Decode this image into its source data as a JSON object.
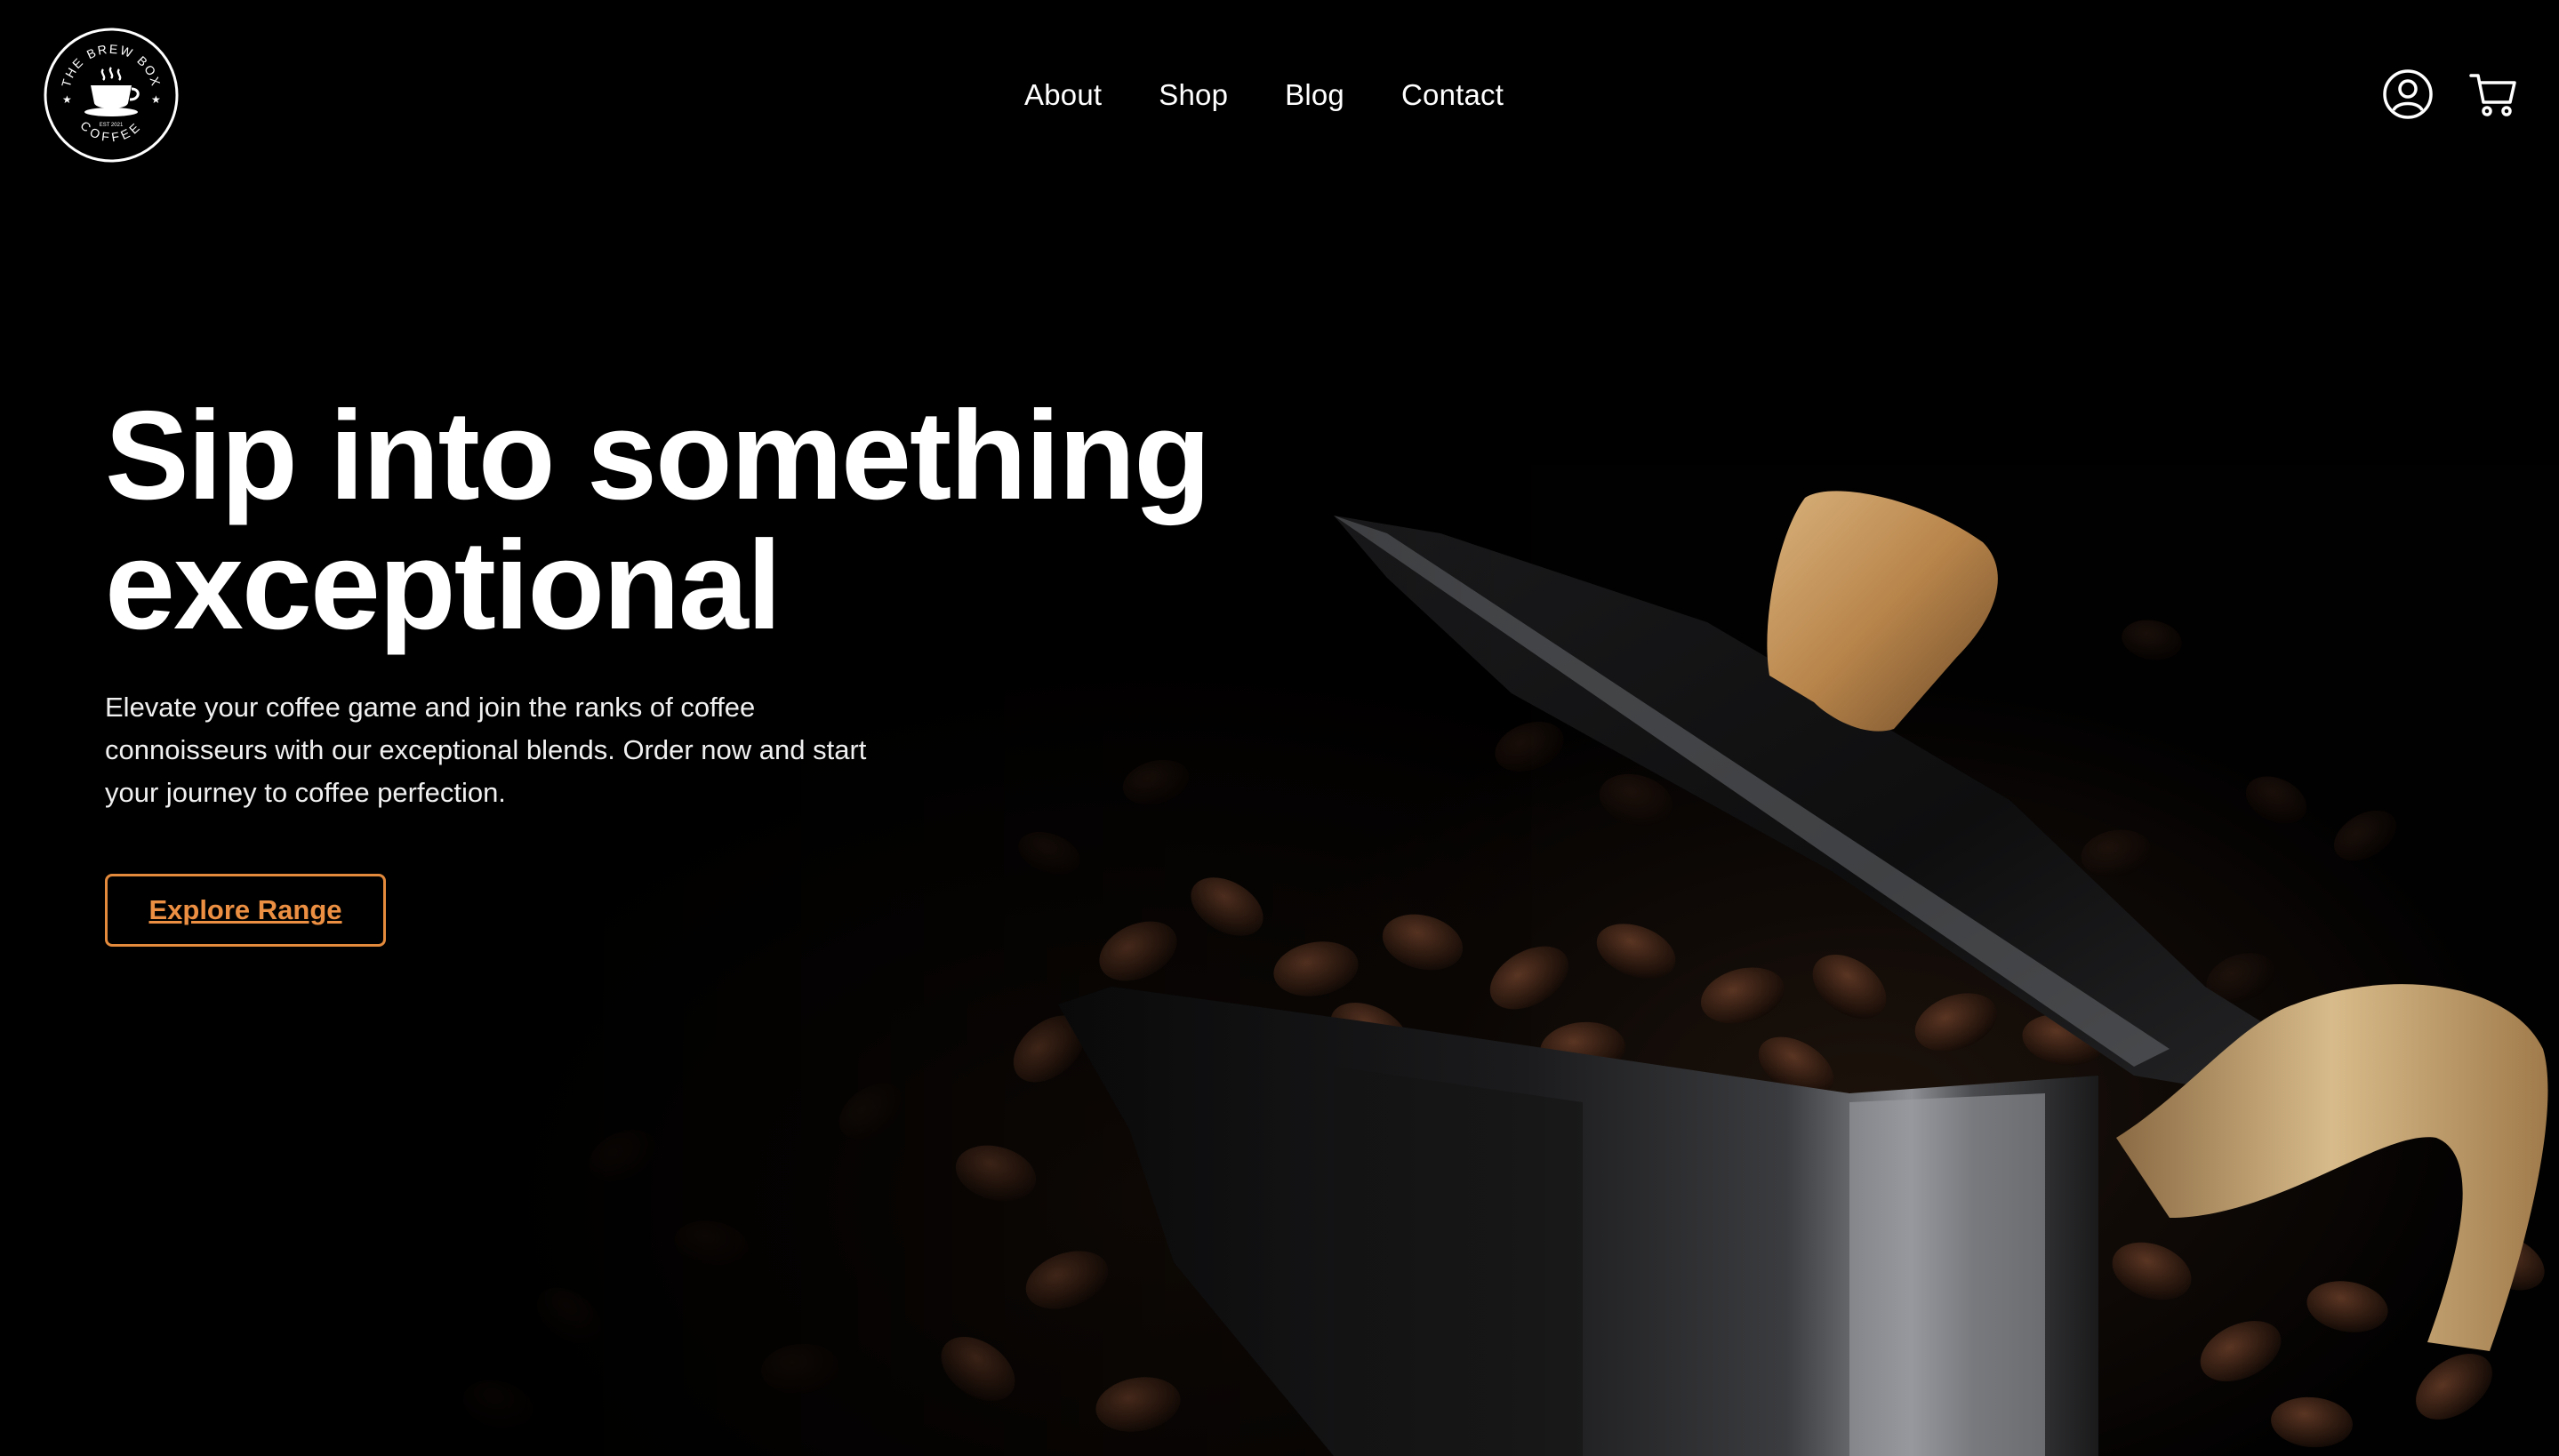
{
  "brand": {
    "name_top": "THE BREW BOX",
    "name_bottom": "COFFEE",
    "established": "EST 2021"
  },
  "nav": {
    "items": [
      {
        "label": "About"
      },
      {
        "label": "Shop"
      },
      {
        "label": "Blog"
      },
      {
        "label": "Contact"
      }
    ]
  },
  "header_icons": [
    "account-icon",
    "cart-icon"
  ],
  "hero": {
    "headline_line1": "Sip into something",
    "headline_line2": "exceptional",
    "subtext": "Elevate your coffee game and join the ranks of coffee connoisseurs with our exceptional blends. Order now and start your journey to coffee perfection.",
    "cta_label": "Explore Range"
  },
  "colors": {
    "background": "#000000",
    "text": "#ffffff",
    "accent": "#e38a3c"
  }
}
